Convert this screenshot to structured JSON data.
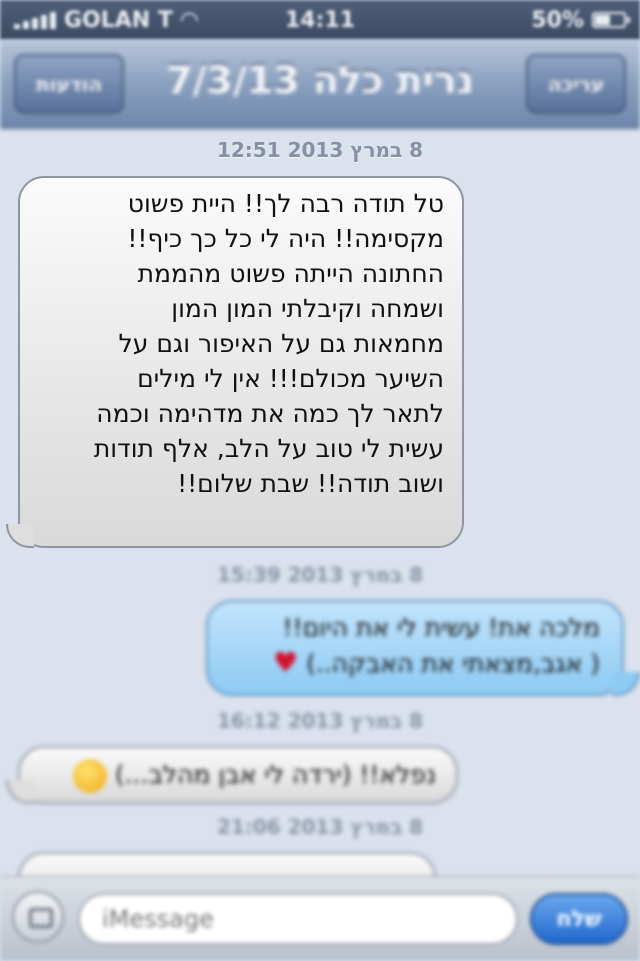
{
  "status_bar": {
    "carrier": "GOLAN T",
    "time": "14:11",
    "battery": "50%",
    "battery_level": 0.5
  },
  "nav": {
    "title": "נרית כלה 7/3/13",
    "back_label": "הודעות",
    "edit_label": "עריכה"
  },
  "messages": [
    {
      "timestamp": "8 במרץ 2013 12:51",
      "direction": "incoming",
      "text": "טל תודה רבה לך!! היית פשוט\nמקסימה!! היה לי כל כך כיף!!\nהחתונה הייתה פשוט מהממת\nושמחה וקיבלתי המון המון\nמחמאות גם על האיפור וגם על\nהשיער מכולם!!! אין לי מילים\nלתאר לך כמה את מדהימה וכמה\nעשית לי טוב על הלב, אלף תודות\nושוב תודה!! שבת שלום!!"
    },
    {
      "timestamp": "8 במרץ 2013 15:39",
      "direction": "outgoing",
      "text_line1": "מלכה את! עשית לי את היום!!",
      "text_line2": "( אגב,מצאתי את האבקה..)",
      "emoji": "heart-emoji"
    },
    {
      "timestamp": "8 במרץ 2013 16:12",
      "direction": "incoming",
      "text": "נפלא!! (ירדה לי אבן מהלב...)",
      "emoji": "smiley-emoji"
    },
    {
      "timestamp": "8 במרץ 2013 21:06",
      "direction": "incoming",
      "text": ""
    }
  ],
  "input": {
    "placeholder": "iMessage",
    "send_label": "שלח",
    "camera_icon": "camera-icon"
  },
  "colors": {
    "background": "#dbe2ed",
    "nav": "#8aa0bf",
    "outgoing_bubble": "#8dcaf3",
    "incoming_bubble": "#e6e6e6",
    "send_button": "#2167cf"
  }
}
